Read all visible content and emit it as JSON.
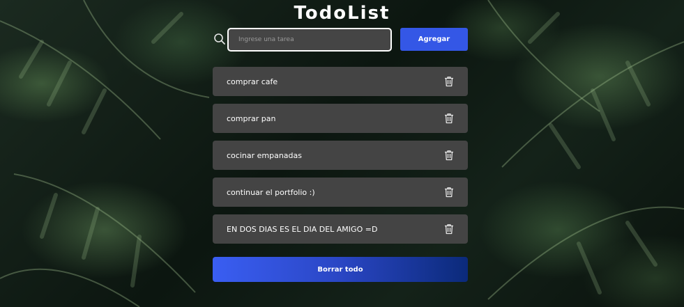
{
  "app": {
    "title": "TodoList"
  },
  "form": {
    "placeholder": "Ingrese una tarea",
    "value": "",
    "add_label": "Agregar",
    "search_icon": "search-icon"
  },
  "todos": [
    {
      "text": "comprar cafe",
      "icon": "trash-icon"
    },
    {
      "text": "comprar pan",
      "icon": "trash-icon"
    },
    {
      "text": "cocinar empanadas",
      "icon": "trash-icon"
    },
    {
      "text": "continuar el portfolio :)",
      "icon": "trash-icon"
    },
    {
      "text": "EN DOS DIAS ES EL DIA DEL AMIGO =D",
      "icon": "trash-icon"
    }
  ],
  "clear_label": "Borrar todo",
  "colors": {
    "accent": "#3457e6",
    "item_bg": "#444444",
    "input_bg": "#454545"
  }
}
